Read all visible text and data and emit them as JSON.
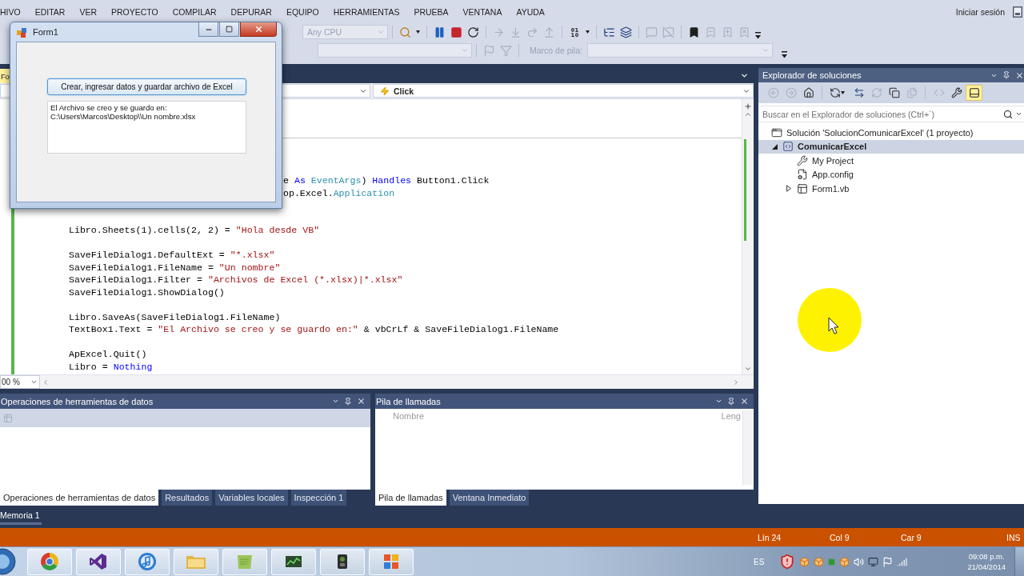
{
  "menu_bar": {
    "items": [
      "HIVO",
      "EDITAR",
      "VER",
      "PROYECTO",
      "COMPILAR",
      "DEPURAR",
      "EQUIPO",
      "HERRAMIENTAS",
      "PRUEBA",
      "VENTANA",
      "AYUDA"
    ],
    "account": "Iniciar sesión"
  },
  "debug_toolbar": {
    "platform": {
      "value": "Any CPU",
      "disabled": true
    },
    "groups": [
      [
        {
          "kind": "browse",
          "disabled": false,
          "dropdown": true
        }
      ],
      [
        {
          "kind": "pause",
          "disabled": false
        },
        {
          "kind": "stop",
          "disabled": false
        },
        {
          "kind": "restart",
          "disabled": false
        }
      ],
      [
        {
          "kind": "show_next",
          "disabled": true
        },
        {
          "kind": "step_into",
          "disabled": true
        },
        {
          "kind": "step_over",
          "disabled": true
        },
        {
          "kind": "step_out",
          "disabled": true
        }
      ],
      [
        {
          "kind": "hex",
          "disabled": false,
          "dropdown": true
        }
      ],
      [
        {
          "kind": "threads",
          "disabled": false
        },
        {
          "kind": "stack",
          "disabled": false
        }
      ],
      [
        {
          "kind": "comment",
          "disabled": true
        },
        {
          "kind": "uncomment",
          "disabled": true
        }
      ],
      [
        {
          "kind": "bookmark",
          "disabled": false
        },
        {
          "kind": "prev_bookmark",
          "disabled": true
        },
        {
          "kind": "next_bookmark",
          "disabled": true
        },
        {
          "kind": "clear_bookmarks",
          "disabled": true
        }
      ]
    ]
  },
  "location_toolbar": {
    "groups": [
      [
        {
          "kind": "flag",
          "disabled": true
        },
        {
          "kind": "filter",
          "disabled": true
        }
      ]
    ],
    "stack_frame": {
      "label": "Marco de pila:",
      "disabled": true
    }
  },
  "document_tabs": [
    {
      "label": "Fo",
      "selected": true
    }
  ],
  "editor": {
    "member": {
      "value": "Click"
    },
    "code": {
      "blocks": [
        [
          {
            "kind": "clipped",
            "tokens": [
              {
                "kind": "plain",
                "text": "e "
              },
              {
                "kind": "keyword",
                "text": "As"
              },
              {
                "kind": "type",
                "text": " EventArgs"
              },
              {
                "kind": "plain",
                "text": ") "
              },
              {
                "kind": "keyword",
                "text": "Handles"
              },
              {
                "kind": "plain",
                "text": " Button1.Click"
              }
            ]
          },
          {
            "kind": "clipped",
            "tokens": [
              {
                "kind": "plain",
                "text": "op.Excel."
              },
              {
                "kind": "type",
                "text": "Application"
              }
            ]
          }
        ],
        [
          {
            "kind": "full",
            "tokens": [
              {
                "kind": "plain",
                "text": "Libro.Sheets(1).cells(2, 2) = "
              },
              {
                "kind": "string",
                "text": "\"Hola desde VB\""
              }
            ]
          }
        ],
        [
          {
            "kind": "full",
            "tokens": [
              {
                "kind": "plain",
                "text": "SaveFileDialog1.DefaultExt = "
              },
              {
                "kind": "string",
                "text": "\"*.xlsx\""
              }
            ]
          },
          {
            "kind": "full",
            "tokens": [
              {
                "kind": "plain",
                "text": "SaveFileDialog1.FileName = "
              },
              {
                "kind": "string",
                "text": "\"Un nombre\""
              }
            ]
          },
          {
            "kind": "full",
            "tokens": [
              {
                "kind": "plain",
                "text": "SaveFileDialog1.Filter = "
              },
              {
                "kind": "string",
                "text": "\"Archivos de Excel (*.xlsx)|*.xlsx\""
              }
            ]
          },
          {
            "kind": "full",
            "tokens": [
              {
                "kind": "plain",
                "text": "SaveFileDialog1.ShowDialog()"
              }
            ]
          }
        ],
        [
          {
            "kind": "full",
            "tokens": [
              {
                "kind": "plain",
                "text": "Libro.SaveAs(SaveFileDialog1.FileName)"
              }
            ]
          },
          {
            "kind": "full",
            "tokens": [
              {
                "kind": "plain",
                "text": "TextBox1.Text = "
              },
              {
                "kind": "string",
                "text": "\"El Archivo se creo y se guardo en:\""
              },
              {
                "kind": "plain",
                "text": " & vbCrLf & SaveFileDialog1.FileName"
              }
            ]
          }
        ],
        [
          {
            "kind": "full",
            "tokens": [
              {
                "kind": "plain",
                "text": "ApExcel.Quit()"
              }
            ]
          },
          {
            "kind": "full",
            "tokens": [
              {
                "kind": "plain",
                "text": "Libro = "
              },
              {
                "kind": "keyword",
                "text": "Nothing"
              }
            ]
          }
        ]
      ]
    },
    "zoom": "00 %"
  },
  "form_window": {
    "title": "Form1",
    "button": "Crear, ingresar datos y guardar archivo de Excel",
    "textbox": {
      "value": "El Archivo se creo y se guardo en:\nC:\\Users\\Marcos\\Desktop\\\\Un nombre.xlsx"
    }
  },
  "solution_explorer": {
    "title": "Explorador de soluciones",
    "toolbar": [
      [
        {
          "kind": "back",
          "disabled": true,
          "on": false
        },
        {
          "kind": "forward",
          "disabled": true,
          "on": false
        },
        {
          "kind": "home",
          "disabled": false,
          "on": false
        }
      ],
      [
        {
          "kind": "sync",
          "disabled": false,
          "on": false,
          "dropdown": true
        },
        {
          "kind": "switch_views",
          "disabled": false,
          "on": false
        },
        {
          "kind": "refresh",
          "disabled": true,
          "on": false
        },
        {
          "kind": "collapse_all",
          "disabled": false,
          "on": false
        },
        {
          "kind": "show_all",
          "disabled": true,
          "on": false
        }
      ],
      [
        {
          "kind": "view_code",
          "disabled": true,
          "on": false
        },
        {
          "kind": "properties",
          "disabled": false,
          "on": false
        },
        {
          "kind": "preview",
          "disabled": false,
          "on": true
        }
      ]
    ],
    "search": {
      "placeholder": "Buscar en el Explorador de soluciones (Ctrl+´)"
    },
    "tree": [
      {
        "label": "Solución 'SolucionComunicarExcel' (1 proyecto)",
        "kind": "solution",
        "selected": false,
        "startup": false,
        "children": [
          {
            "label": "ComunicarExcel",
            "kind": "project",
            "selected": true,
            "startup": true,
            "expanded": true,
            "children": [
              {
                "label": "My Project",
                "kind": "properties",
                "selected": false,
                "startup": false
              },
              {
                "label": "App.config",
                "kind": "config",
                "selected": false,
                "startup": false
              },
              {
                "label": "Form1.vb",
                "kind": "form",
                "selected": false,
                "startup": false,
                "expanded": false
              }
            ]
          }
        ]
      }
    ]
  },
  "bottom_panels": [
    {
      "kind": "data_tools",
      "title": "Operaciones de herramientas de datos",
      "tabs": [
        {
          "label": "Operaciones de herramientas de datos",
          "selected": true
        },
        {
          "label": "Resultados",
          "selected": false
        },
        {
          "label": "Variables locales",
          "selected": false
        },
        {
          "label": "Inspección 1",
          "selected": false
        }
      ]
    },
    {
      "kind": "call_stack",
      "title": "Pila de llamadas",
      "columns": [
        "Nombre",
        "Leng"
      ],
      "tabs": [
        {
          "label": "Pila de llamadas",
          "selected": true
        },
        {
          "label": "Ventana Inmediato",
          "selected": false
        }
      ]
    }
  ],
  "auto_hide_tabs": [
    "Memoria 1"
  ],
  "status_bar": {
    "items": [
      "Lín 24",
      "Col 9",
      "Car 9",
      "INS"
    ]
  },
  "taskbar": {
    "language": "ES",
    "time": "09:08 p.m.",
    "date": "21/04/2014"
  }
}
